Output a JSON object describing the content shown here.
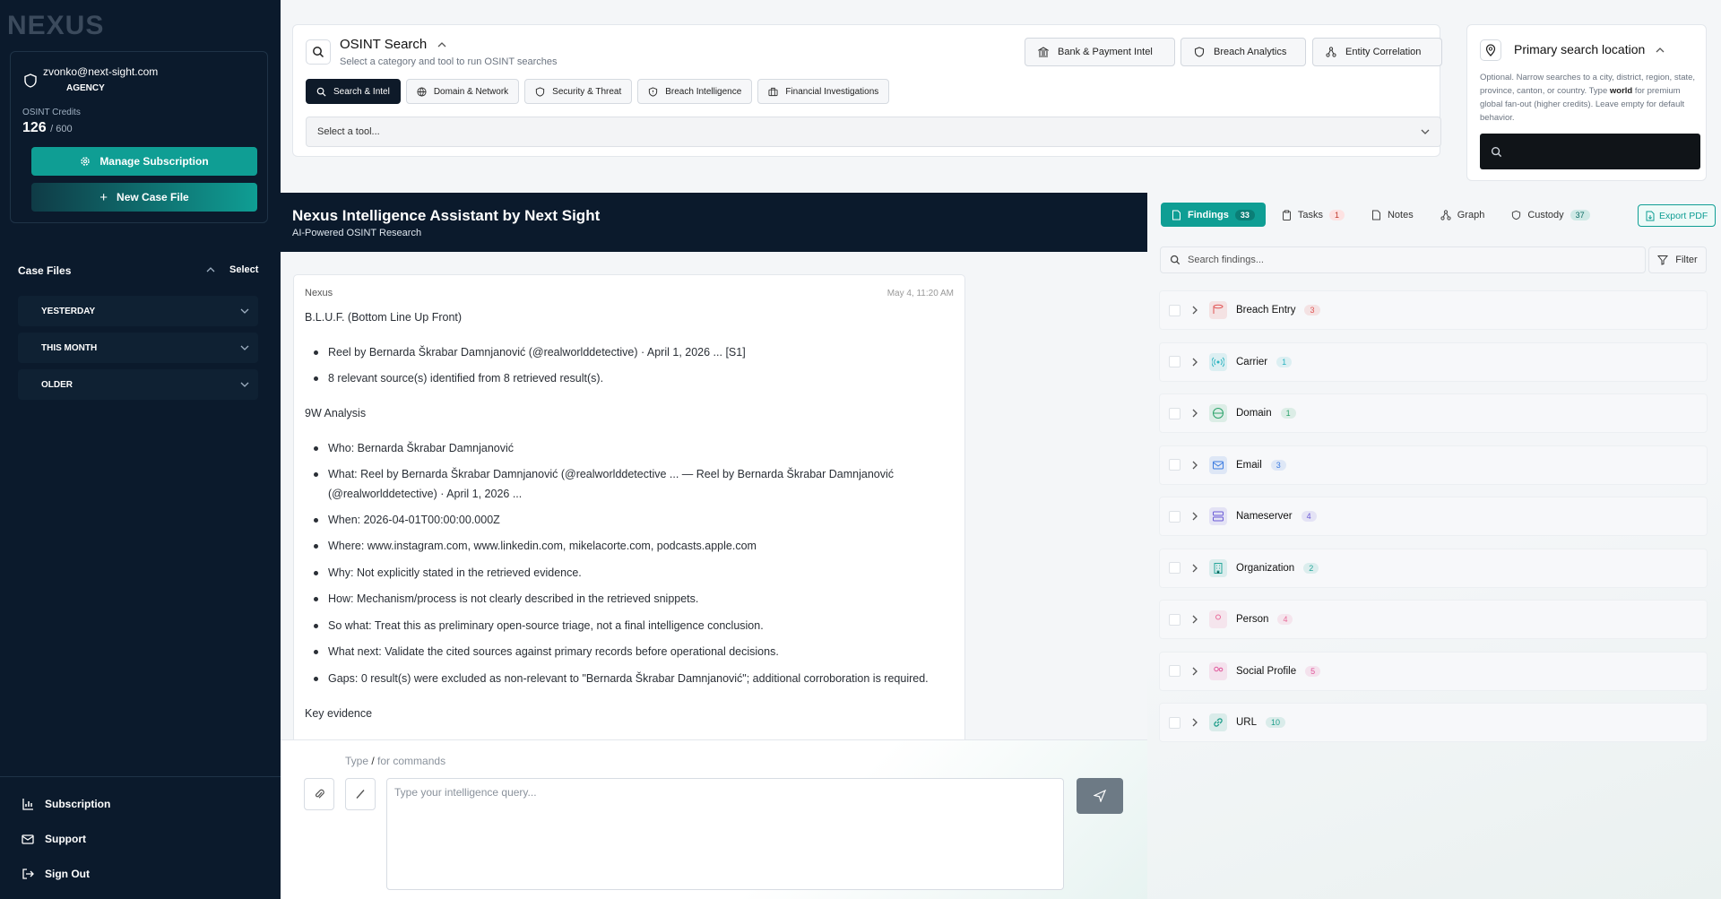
{
  "sidebar": {
    "logo": "NEXUS",
    "email": "zvonko@next-sight.com",
    "plan": "AGENCY",
    "credits_label": "OSINT Credits",
    "credits_used": "126",
    "credits_total": "/ 600",
    "manage_label": "Manage Subscription",
    "new_case_label": "New Case File",
    "case_files_title": "Case Files",
    "select_label": "Select",
    "groups": [
      "YESTERDAY",
      "THIS MONTH",
      "OLDER"
    ],
    "footer": [
      "Subscription",
      "Support",
      "Sign Out"
    ]
  },
  "search": {
    "title": "OSINT Search",
    "subtitle": "Select a category and tool to run OSINT searches",
    "quick": [
      "Bank & Payment Intel",
      "Breach Analytics",
      "Entity Correlation"
    ],
    "categories": [
      "Search & Intel",
      "Domain & Network",
      "Security & Threat",
      "Breach Intelligence",
      "Financial Investigations"
    ],
    "tool_placeholder": "Select a tool..."
  },
  "location": {
    "title": "Primary search location",
    "desc_1": "Optional. Narrow searches to a city, district, region, state, province, canton, or country. Type ",
    "desc_bold": "world",
    "desc_2": " for premium global fan-out (higher credits). Leave empty for default behavior."
  },
  "chat": {
    "title": "Nexus Intelligence Assistant by Next Sight",
    "subtitle": "AI-Powered OSINT Research",
    "author": "Nexus",
    "time": "May 4, 11:20 AM",
    "bluf_heading": "B.L.U.F. (Bottom Line Up Front)",
    "bluf": [
      "Reel by Bernarda Škrabar Damnjanović (@realworlddetective) · April 1, 2026 ... [S1]",
      "8 relevant source(s) identified from 8 retrieved result(s)."
    ],
    "analysis_heading": "9W Analysis",
    "analysis": [
      "Who: Bernarda Škrabar Damnjanović",
      "What: Reel by Bernarda Škrabar Damnjanović (@realworlddetective ... — Reel by Bernarda Škrabar Damnjanović (@realworlddetective) · April 1, 2026 ...",
      "When: 2026-04-01T00:00:00.000Z",
      "Where: www.instagram.com, www.linkedin.com, mikelacorte.com, podcasts.apple.com",
      "Why: Not explicitly stated in the retrieved evidence.",
      "How: Mechanism/process is not clearly described in the retrieved snippets.",
      "So what: Treat this as preliminary open-source triage, not a final intelligence conclusion.",
      "What next: Validate the cited sources against primary records before operational decisions.",
      "Gaps: 0 result(s) were excluded as non-relevant to \"Bernarda Škrabar Damnjanović\"; additional corroboration is required."
    ],
    "key_evidence": "Key evidence",
    "hint_1": "Type ",
    "hint_slash": "/",
    "hint_2": " for commands",
    "placeholder": "Type your intelligence query..."
  },
  "findings": {
    "tabs": [
      {
        "label": "Findings",
        "count": "33"
      },
      {
        "label": "Tasks",
        "count": "1"
      },
      {
        "label": "Notes",
        "count": ""
      },
      {
        "label": "Graph",
        "count": ""
      },
      {
        "label": "Custody",
        "count": "37"
      }
    ],
    "export_label": "Export PDF",
    "search_placeholder": "Search findings...",
    "filter_label": "Filter",
    "rows": [
      {
        "label": "Breach Entry",
        "count": "3",
        "color": "#e05555"
      },
      {
        "label": "Carrier",
        "count": "1",
        "color": "#2bb3c0"
      },
      {
        "label": "Domain",
        "count": "1",
        "color": "#2ca36b"
      },
      {
        "label": "Email",
        "count": "3",
        "color": "#3b7be0"
      },
      {
        "label": "Nameserver",
        "count": "4",
        "color": "#6b5bd6"
      },
      {
        "label": "Organization",
        "count": "2",
        "color": "#26a69a"
      },
      {
        "label": "Person",
        "count": "4",
        "color": "#e86c9a"
      },
      {
        "label": "Social Profile",
        "count": "5",
        "color": "#e0559a"
      },
      {
        "label": "URL",
        "count": "10",
        "color": "#1f9e8a"
      }
    ]
  }
}
